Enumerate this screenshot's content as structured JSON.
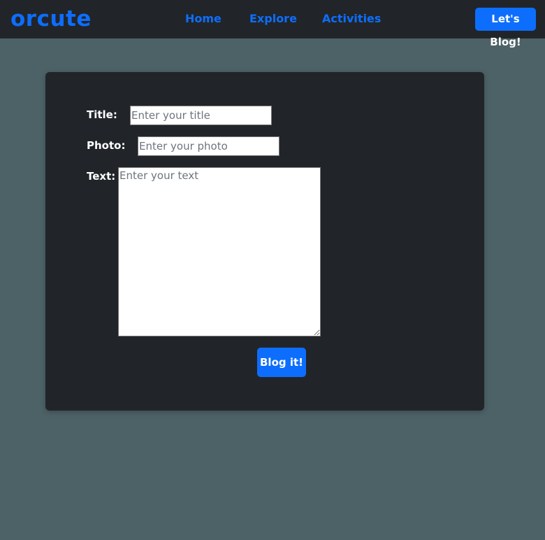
{
  "navbar": {
    "brand": "orcute",
    "links": [
      {
        "label": "Home"
      },
      {
        "label": "Explore"
      },
      {
        "label": "Activities"
      }
    ],
    "cta_label": "Let's Blog!"
  },
  "form": {
    "title_label": "Title:",
    "title_placeholder": "Enter your title",
    "title_value": "",
    "photo_label": "Photo:",
    "photo_placeholder": "Enter your photo",
    "photo_value": "",
    "text_label": "Text:",
    "text_placeholder": "Enter your text",
    "text_value": "",
    "submit_label": "Blog it!"
  },
  "colors": {
    "page_background": "#4d6267",
    "navbar_background": "#212529",
    "card_background": "#212529",
    "accent": "#0d6efd",
    "label_text": "#ffffff"
  }
}
